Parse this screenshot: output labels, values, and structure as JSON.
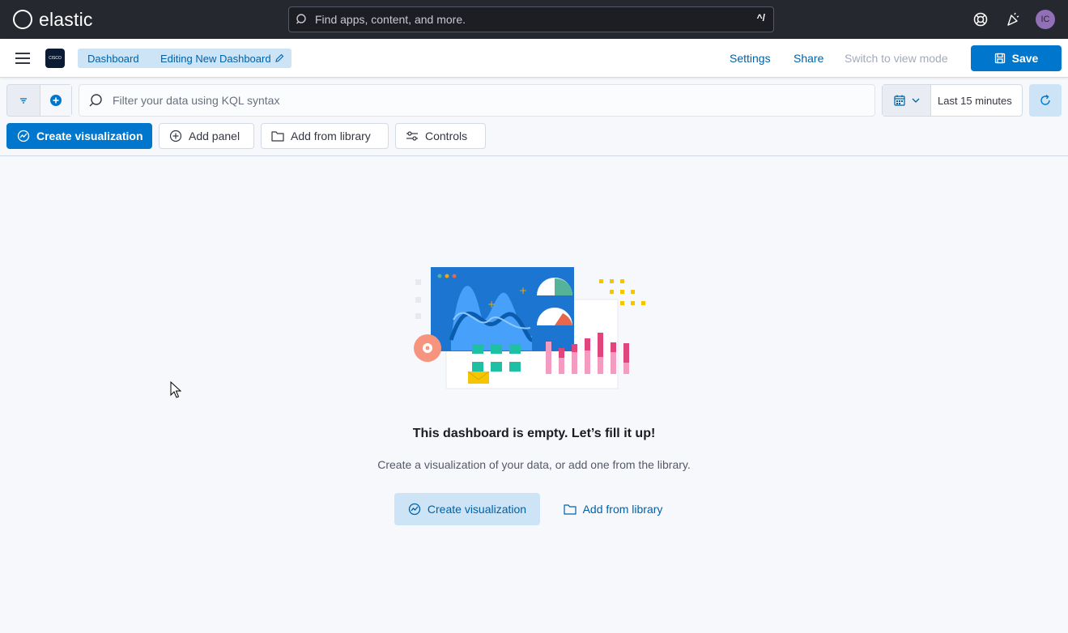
{
  "header": {
    "brand": "elastic",
    "search_placeholder": "Find apps, content, and more.",
    "search_shortcut": "^/",
    "avatar_initials": "IC"
  },
  "subheader": {
    "space_logo_text": "CISCO",
    "breadcrumbs": [
      "Dashboard",
      "Editing New Dashboard"
    ],
    "settings": "Settings",
    "share": "Share",
    "switch_mode": "Switch to view mode",
    "save": "Save"
  },
  "query": {
    "placeholder": "Filter your data using KQL syntax",
    "time_range": "Last 15 minutes"
  },
  "toolbar": {
    "create_visualization": "Create visualization",
    "add_panel": "Add panel",
    "add_from_library": "Add from library",
    "controls": "Controls"
  },
  "empty_state": {
    "title": "This dashboard is empty. Let’s fill it up!",
    "subtitle": "Create a visualization of your data, or add one from the library.",
    "create_visualization": "Create visualization",
    "add_from_library": "Add from library"
  },
  "colors": {
    "topbar": "#25282f",
    "primary": "#0077cc",
    "primary_light": "#cce4f5",
    "link": "#0061a6",
    "avatar": "#9170b8"
  }
}
